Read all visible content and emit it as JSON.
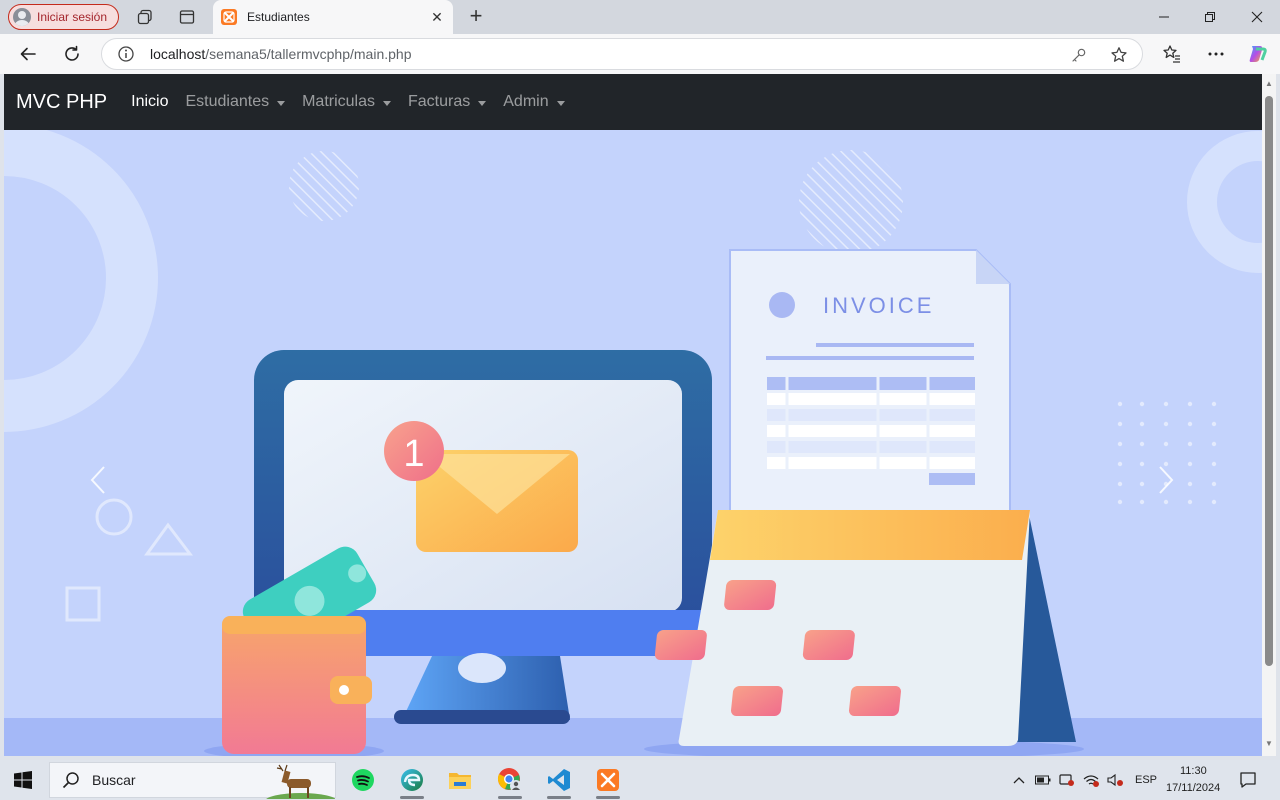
{
  "browser": {
    "profile_label": "Iniciar sesión",
    "tab_title": "Estudiantes",
    "url_host": "localhost",
    "url_path": "/semana5/tallermvcphp/main.php"
  },
  "navbar": {
    "brand": "MVC PHP",
    "items": [
      {
        "label": "Inicio",
        "active": true,
        "dropdown": false
      },
      {
        "label": "Estudiantes",
        "active": false,
        "dropdown": true
      },
      {
        "label": "Matriculas",
        "active": false,
        "dropdown": true
      },
      {
        "label": "Facturas",
        "active": false,
        "dropdown": true
      },
      {
        "label": "Admin",
        "active": false,
        "dropdown": true
      }
    ]
  },
  "carousel": {
    "invoice_title": "INVOICE",
    "notification_count": "1"
  },
  "taskbar": {
    "search_label": "Buscar",
    "language": "ESP",
    "time": "11:30",
    "date": "17/11/2024"
  },
  "colors": {
    "navbar_bg": "#212529",
    "carousel_bg": "#c4d3fc",
    "accent_orange": "#fbb150",
    "accent_pink": "#f07a8a"
  }
}
